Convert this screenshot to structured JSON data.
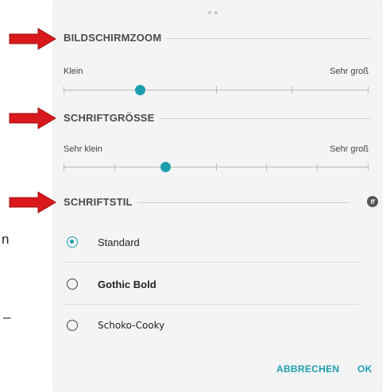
{
  "side_text": {
    "top": "n",
    "bottom": "–"
  },
  "sections": {
    "zoom": {
      "title": "BILDSCHIRMZOOM",
      "min_label": "Klein",
      "max_label": "Sehr groß",
      "steps": 5,
      "value_index": 1
    },
    "font_size": {
      "title": "SCHRIFTGRÖSSE",
      "min_label": "Sehr klein",
      "max_label": "Sehr groß",
      "steps": 7,
      "value_index": 2
    },
    "font_style": {
      "title": "SCHRIFTSTIL",
      "icon_glyph": "ff",
      "options": [
        {
          "label": "Standard",
          "checked": true
        },
        {
          "label": "Gothic Bold",
          "checked": false
        },
        {
          "label": "Schoko-Cooky",
          "checked": false
        }
      ]
    }
  },
  "actions": {
    "cancel": "ABBRECHEN",
    "ok": "OK"
  },
  "colors": {
    "accent": "#1b9fae",
    "arrow": "#d9191c"
  }
}
